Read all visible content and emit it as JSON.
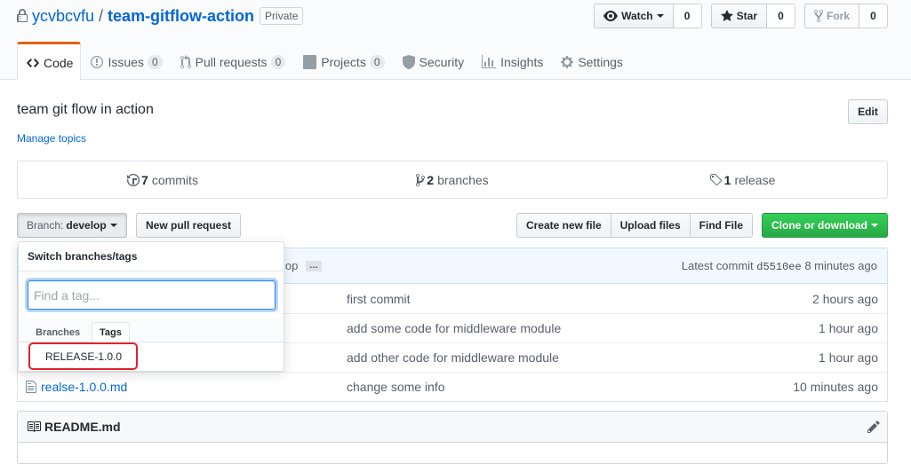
{
  "header": {
    "owner": "ycvbcvfu",
    "separator": "/",
    "repo": "team-gitflow-action",
    "visibility": "Private",
    "watch": {
      "label": "Watch",
      "count": "0"
    },
    "star": {
      "label": "Star",
      "count": "0"
    },
    "fork": {
      "label": "Fork",
      "count": "0"
    }
  },
  "nav": {
    "code": "Code",
    "issues": "Issues",
    "issues_count": "0",
    "pulls": "Pull requests",
    "pulls_count": "0",
    "projects": "Projects",
    "projects_count": "0",
    "security": "Security",
    "insights": "Insights",
    "settings": "Settings"
  },
  "repo": {
    "description": "team git flow in action",
    "manage_topics": "Manage topics",
    "edit": "Edit"
  },
  "summary": {
    "commits_num": "7",
    "commits_label": "commits",
    "branches_num": "2",
    "branches_label": "branches",
    "releases_num": "1",
    "releases_label": "release"
  },
  "toolbar": {
    "branch_label": "Branch:",
    "branch_name": "develop",
    "new_pr": "New pull request",
    "create_file": "Create new file",
    "upload_files": "Upload files",
    "find_file": "Find File",
    "clone": "Clone or download"
  },
  "commit_tease": {
    "message_fragment": "lop",
    "ellipsis": "…",
    "latest_label": "Latest commit",
    "sha": "d5510ee",
    "age": "8 minutes ago"
  },
  "files": [
    {
      "name": "",
      "message": "first commit",
      "age": "2 hours ago"
    },
    {
      "name": "",
      "message": "add some code for middleware module",
      "age": "1 hour ago"
    },
    {
      "name": "",
      "message": "add other code for middleware module",
      "age": "1 hour ago"
    },
    {
      "name": "realse-1.0.0.md",
      "message": "change some info",
      "age": "10 minutes ago"
    }
  ],
  "readme": {
    "title": "README.md"
  },
  "dropdown": {
    "title": "Switch branches/tags",
    "placeholder": "Find a tag...",
    "tab_branches": "Branches",
    "tab_tags": "Tags",
    "item": "RELEASE-1.0.0"
  }
}
